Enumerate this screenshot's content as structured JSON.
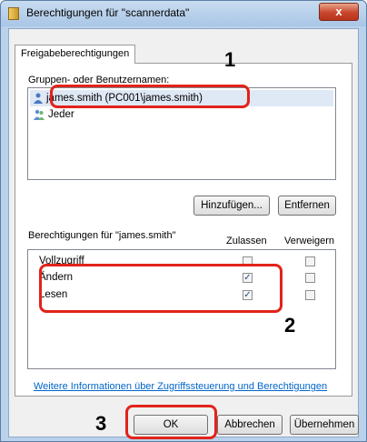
{
  "window": {
    "title": "Berechtigungen für \"scannerdata\"",
    "close_label": "x"
  },
  "tab": {
    "label": "Freigabeberechtigungen"
  },
  "groups": {
    "label": "Gruppen- oder Benutzernamen:",
    "items": [
      {
        "label": "james.smith (PC001\\james.smith)",
        "selected": true
      },
      {
        "label": "Jeder",
        "selected": false
      }
    ],
    "add_button": "Hinzufügen...",
    "remove_button": "Entfernen"
  },
  "permissions": {
    "label": "Berechtigungen für \"james.smith\"",
    "allow_header": "Zulassen",
    "deny_header": "Verweigern",
    "rows": [
      {
        "name": "Vollzugriff",
        "allow": false,
        "deny": false
      },
      {
        "name": "Ändern",
        "allow": true,
        "deny": false
      },
      {
        "name": "Lesen",
        "allow": true,
        "deny": false
      }
    ]
  },
  "info_link": "Weitere Informationen über Zugriffssteuerung und Berechtigungen",
  "buttons": {
    "ok": "OK",
    "cancel": "Abbrechen",
    "apply": "Übernehmen"
  },
  "callouts": {
    "one": "1",
    "two": "2",
    "three": "3"
  },
  "colors": {
    "callout": "#e2231a",
    "link": "#0066cc",
    "title_bar": "#b9d1ea"
  }
}
